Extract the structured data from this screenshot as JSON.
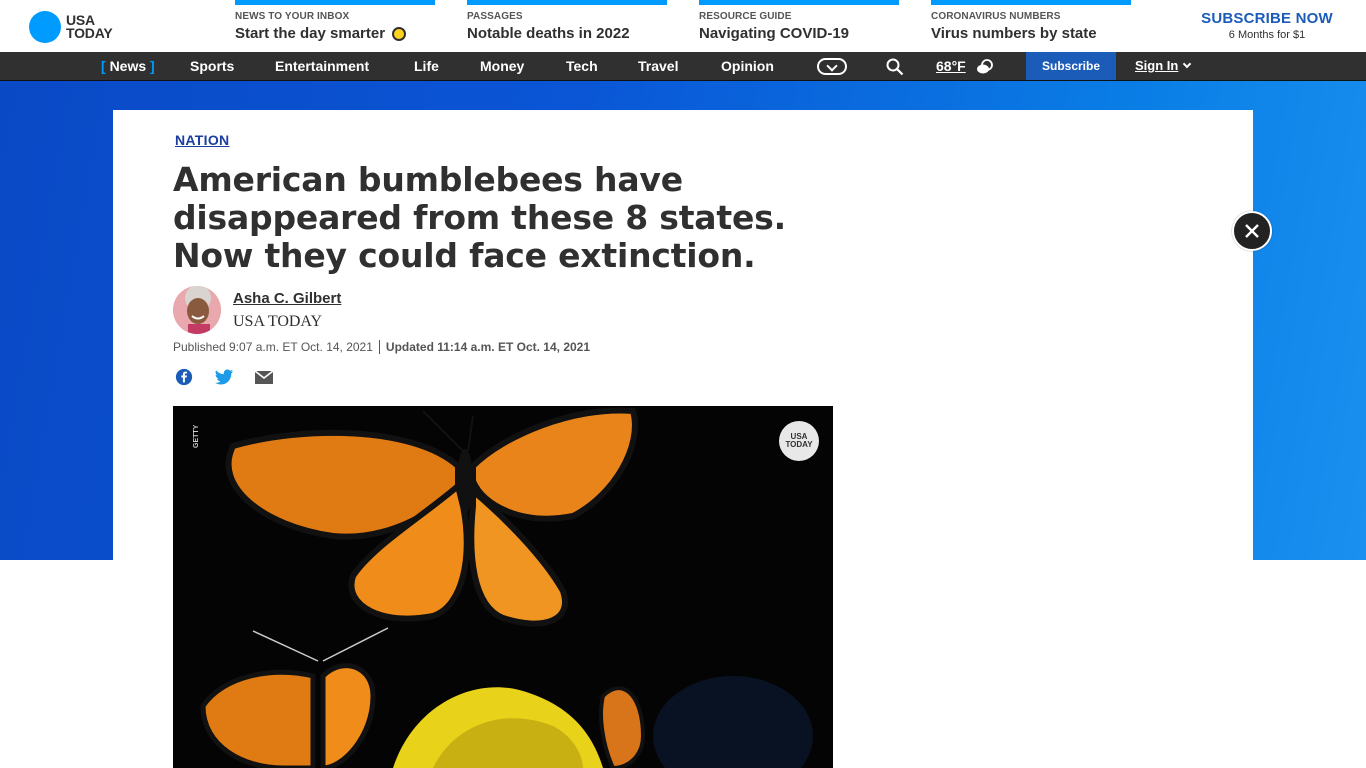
{
  "header": {
    "logo_line1": "USA",
    "logo_line2": "TODAY",
    "promos": [
      {
        "kicker": "NEWS TO YOUR INBOX",
        "headline": "Start the day smarter"
      },
      {
        "kicker": "PASSAGES",
        "headline": "Notable deaths in 2022"
      },
      {
        "kicker": "RESOURCE GUIDE",
        "headline": "Navigating COVID-19"
      },
      {
        "kicker": "CORONAVIRUS NUMBERS",
        "headline": "Virus numbers by state"
      }
    ],
    "subscribe_title": "SUBSCRIBE NOW",
    "subscribe_sub": "6 Months for $1"
  },
  "nav": {
    "items": [
      {
        "label": "News",
        "active": true
      },
      {
        "label": "Sports"
      },
      {
        "label": "Entertainment"
      },
      {
        "label": "Life"
      },
      {
        "label": "Money"
      },
      {
        "label": "Tech"
      },
      {
        "label": "Travel"
      },
      {
        "label": "Opinion"
      }
    ],
    "bracket_open": "[",
    "bracket_close": "]",
    "weather": "68°F",
    "subscribe": "Subscribe",
    "signin": "Sign In"
  },
  "article": {
    "section": "NATION",
    "title": "American bumblebees have disappeared from these 8 states. Now they could face extinction.",
    "author": "Asha C. Gilbert",
    "org": "USA TODAY",
    "published": "Published 9:07 a.m. ET Oct. 14, 2021",
    "updated_label": "Updated",
    "updated": "11:14 a.m. ET Oct. 14, 2021"
  },
  "video": {
    "credit": "GETTY",
    "badge_line1": "USA",
    "badge_line2": "TODAY"
  },
  "colors": {
    "accent": "#009bff",
    "brand_blue": "#1b5cb8",
    "nav_bg": "#303030"
  },
  "icons": [
    "facebook-icon",
    "twitter-icon",
    "mail-icon",
    "search-icon",
    "weather-icon",
    "close-icon",
    "chevron-down-icon"
  ]
}
